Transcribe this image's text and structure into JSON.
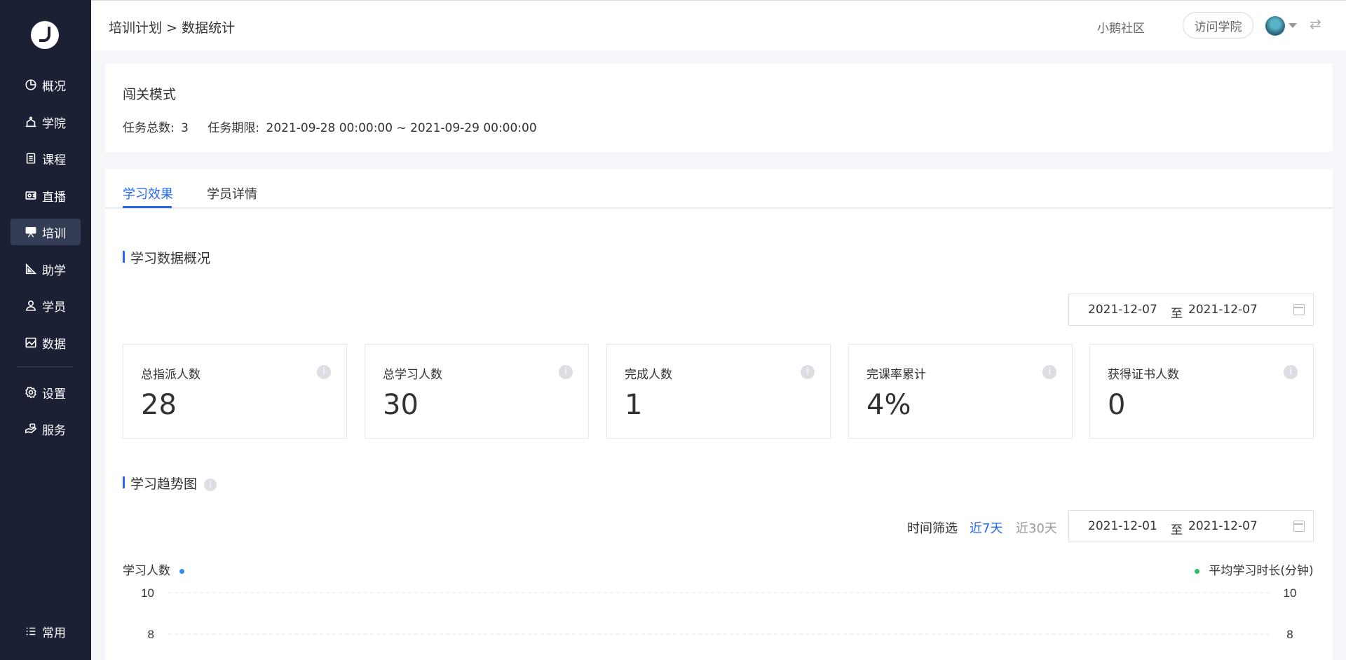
{
  "sidebar": {
    "items": [
      {
        "label": "概况",
        "icon": "pie-chart-icon",
        "active": false
      },
      {
        "label": "学院",
        "icon": "academy-icon",
        "active": false
      },
      {
        "label": "课程",
        "icon": "course-icon",
        "active": false
      },
      {
        "label": "直播",
        "icon": "live-icon",
        "active": false
      },
      {
        "label": "培训",
        "icon": "training-icon",
        "active": true
      },
      {
        "label": "助学",
        "icon": "assist-icon",
        "active": false
      },
      {
        "label": "学员",
        "icon": "user-icon",
        "active": false
      },
      {
        "label": "数据",
        "icon": "data-icon",
        "active": false
      }
    ],
    "settings": [
      {
        "label": "设置",
        "icon": "gear-icon"
      },
      {
        "label": "服务",
        "icon": "service-icon"
      }
    ],
    "common_label": "常用"
  },
  "header": {
    "breadcrumb": "培训计划 > 数据统计",
    "community_link": "小鹅社区",
    "visit_button": "访问学院"
  },
  "task": {
    "title": "闯关模式",
    "total_label": "任务总数:",
    "total_value": "3",
    "period_label": "任务期限:",
    "period_value": "2021-09-28 00:00:00 ~ 2021-09-29 00:00:00"
  },
  "tabs": [
    {
      "label": "学习效果",
      "active": true
    },
    {
      "label": "学员详情",
      "active": false
    }
  ],
  "overview": {
    "title": "学习数据概况",
    "date_start": "2021-12-07",
    "date_sep": "至",
    "date_end": "2021-12-07",
    "cards": [
      {
        "label": "总指派人数",
        "value": "28"
      },
      {
        "label": "总学习人数",
        "value": "30"
      },
      {
        "label": "完成人数",
        "value": "1"
      },
      {
        "label": "完课率累计",
        "value": "4%"
      },
      {
        "label": "获得证书人数",
        "value": "0"
      }
    ]
  },
  "trend": {
    "title": "学习趋势图",
    "filter_label": "时间筛选",
    "filter_7": "近7天",
    "filter_30": "近30天",
    "date_start": "2021-12-01",
    "date_sep": "至",
    "date_end": "2021-12-07",
    "left_axis_label": "学习人数",
    "right_axis_label": "平均学习时长(分钟)"
  },
  "colors": {
    "accent": "#2468f2",
    "sidebar_bg": "#1b2035",
    "series_left": "#2b8cf5",
    "series_right": "#29c15e"
  },
  "chart_data": {
    "type": "line",
    "series": [
      {
        "name": "学习人数",
        "axis": "left",
        "values": []
      },
      {
        "name": "平均学习时长(分钟)",
        "axis": "right",
        "values": []
      }
    ],
    "y_ticks_visible": [
      10,
      8
    ],
    "ylim_left": [
      0,
      10
    ],
    "ylim_right": [
      0,
      10
    ],
    "grid": true
  }
}
